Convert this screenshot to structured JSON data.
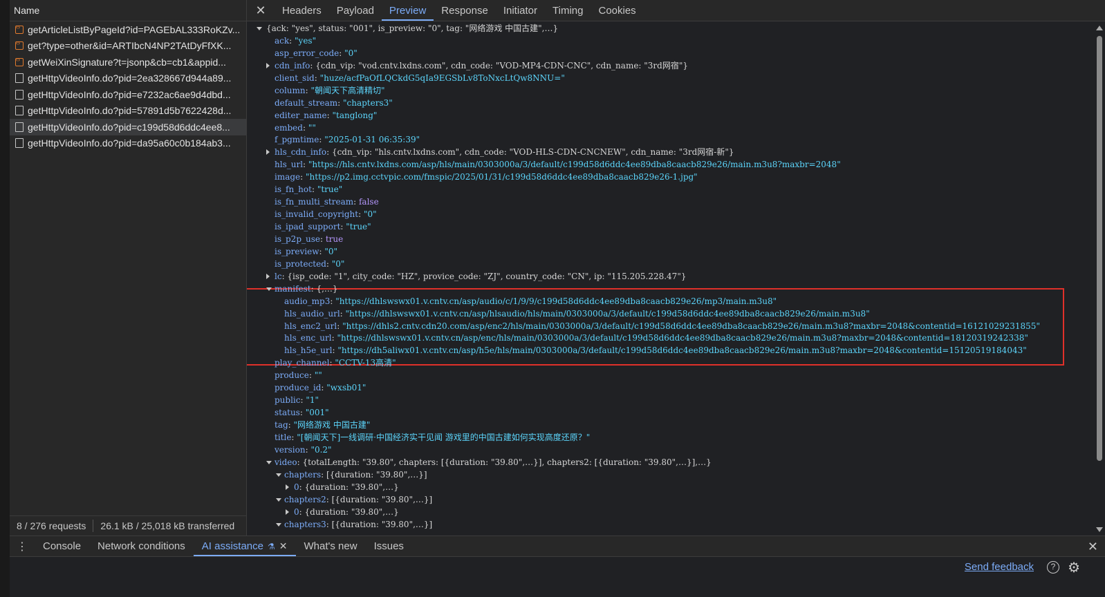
{
  "left_panel": {
    "column_header": "Name",
    "requests": [
      {
        "name": "getArticleListByPageId?id=PAGEbAL333RoKZv...",
        "type": "script",
        "selected": false
      },
      {
        "name": "get?type=other&id=ARTIbcN4NP2TAtDyFfXK...",
        "type": "script",
        "selected": false
      },
      {
        "name": "getWeiXinSignature?t=jsonp&cb=cb1&appid...",
        "type": "script",
        "selected": false
      },
      {
        "name": "getHttpVideoInfo.do?pid=2ea328667d944a89...",
        "type": "doc",
        "selected": false
      },
      {
        "name": "getHttpVideoInfo.do?pid=e7232ac6ae9d4dbd...",
        "type": "doc",
        "selected": false
      },
      {
        "name": "getHttpVideoInfo.do?pid=57891d5b7622428d...",
        "type": "doc",
        "selected": false
      },
      {
        "name": "getHttpVideoInfo.do?pid=c199d58d6ddc4ee8...",
        "type": "doc",
        "selected": true
      },
      {
        "name": "getHttpVideoInfo.do?pid=da95a60c0b184ab3...",
        "type": "doc",
        "selected": false
      }
    ],
    "status": {
      "requests": "8 / 276 requests",
      "transferred": "26.1 kB / 25,018 kB transferred"
    }
  },
  "detail_tabs": {
    "close": "✕",
    "tabs": [
      "Headers",
      "Payload",
      "Preview",
      "Response",
      "Initiator",
      "Timing",
      "Cookies"
    ],
    "active": "Preview"
  },
  "preview_lines": [
    {
      "indent": 0,
      "tri": "down",
      "parts": [
        {
          "c": "t",
          "v": "{ack: \"yes\", status: \"001\", is_preview: \"0\", tag: \"网络游戏 中国古建\",…}"
        }
      ]
    },
    {
      "indent": 1,
      "parts": [
        {
          "c": "k",
          "v": "ack"
        },
        {
          "c": "p",
          "v": ": "
        },
        {
          "c": "s",
          "v": "\"yes\""
        }
      ]
    },
    {
      "indent": 1,
      "parts": [
        {
          "c": "k",
          "v": "asp_error_code"
        },
        {
          "c": "p",
          "v": ": "
        },
        {
          "c": "s",
          "v": "\"0\""
        }
      ]
    },
    {
      "indent": 1,
      "tri": "right",
      "parts": [
        {
          "c": "k",
          "v": "cdn_info"
        },
        {
          "c": "p",
          "v": ": {cdn_vip: \"vod.cntv.lxdns.com\", cdn_code: \"VOD-MP4-CDN-CNC\", cdn_name: \"3rd网宿\"}"
        }
      ]
    },
    {
      "indent": 1,
      "parts": [
        {
          "c": "k",
          "v": "client_sid"
        },
        {
          "c": "p",
          "v": ": "
        },
        {
          "c": "s",
          "v": "\"huze/acfPaOfLQCkdG5qIa9EGSbLv8ToNxcLtQw8NNU=\""
        }
      ]
    },
    {
      "indent": 1,
      "parts": [
        {
          "c": "k",
          "v": "column"
        },
        {
          "c": "p",
          "v": ": "
        },
        {
          "c": "s",
          "v": "\"朝闻天下高清精切\""
        }
      ]
    },
    {
      "indent": 1,
      "parts": [
        {
          "c": "k",
          "v": "default_stream"
        },
        {
          "c": "p",
          "v": ": "
        },
        {
          "c": "s",
          "v": "\"chapters3\""
        }
      ]
    },
    {
      "indent": 1,
      "parts": [
        {
          "c": "k",
          "v": "editer_name"
        },
        {
          "c": "p",
          "v": ": "
        },
        {
          "c": "s",
          "v": "\"tanglong\""
        }
      ]
    },
    {
      "indent": 1,
      "parts": [
        {
          "c": "k",
          "v": "embed"
        },
        {
          "c": "p",
          "v": ": "
        },
        {
          "c": "s",
          "v": "\"\""
        }
      ]
    },
    {
      "indent": 1,
      "parts": [
        {
          "c": "k",
          "v": "f_pgmtime"
        },
        {
          "c": "p",
          "v": ": "
        },
        {
          "c": "s",
          "v": "\"2025-01-31 06:35:39\""
        }
      ]
    },
    {
      "indent": 1,
      "tri": "right",
      "parts": [
        {
          "c": "k",
          "v": "hls_cdn_info"
        },
        {
          "c": "p",
          "v": ": {cdn_vip: \"hls.cntv.lxdns.com\", cdn_code: \"VOD-HLS-CDN-CNCNEW\", cdn_name: \"3rd网宿-新\"}"
        }
      ]
    },
    {
      "indent": 1,
      "parts": [
        {
          "c": "k",
          "v": "hls_url"
        },
        {
          "c": "p",
          "v": ": "
        },
        {
          "c": "s",
          "v": "\"https://hls.cntv.lxdns.com/asp/hls/main/0303000a/3/default/c199d58d6ddc4ee89dba8caacb829e26/main.m3u8?maxbr=2048\""
        }
      ]
    },
    {
      "indent": 1,
      "parts": [
        {
          "c": "k",
          "v": "image"
        },
        {
          "c": "p",
          "v": ": "
        },
        {
          "c": "s",
          "v": "\"https://p2.img.cctvpic.com/fmspic/2025/01/31/c199d58d6ddc4ee89dba8caacb829e26-1.jpg\""
        }
      ]
    },
    {
      "indent": 1,
      "parts": [
        {
          "c": "k",
          "v": "is_fn_hot"
        },
        {
          "c": "p",
          "v": ": "
        },
        {
          "c": "s",
          "v": "\"true\""
        }
      ]
    },
    {
      "indent": 1,
      "parts": [
        {
          "c": "k",
          "v": "is_fn_multi_stream"
        },
        {
          "c": "p",
          "v": ": "
        },
        {
          "c": "n",
          "v": "false"
        }
      ]
    },
    {
      "indent": 1,
      "parts": [
        {
          "c": "k",
          "v": "is_invalid_copyright"
        },
        {
          "c": "p",
          "v": ": "
        },
        {
          "c": "s",
          "v": "\"0\""
        }
      ]
    },
    {
      "indent": 1,
      "parts": [
        {
          "c": "k",
          "v": "is_ipad_support"
        },
        {
          "c": "p",
          "v": ": "
        },
        {
          "c": "s",
          "v": "\"true\""
        }
      ]
    },
    {
      "indent": 1,
      "parts": [
        {
          "c": "k",
          "v": "is_p2p_use"
        },
        {
          "c": "p",
          "v": ": "
        },
        {
          "c": "n",
          "v": "true"
        }
      ]
    },
    {
      "indent": 1,
      "parts": [
        {
          "c": "k",
          "v": "is_preview"
        },
        {
          "c": "p",
          "v": ": "
        },
        {
          "c": "s",
          "v": "\"0\""
        }
      ]
    },
    {
      "indent": 1,
      "parts": [
        {
          "c": "k",
          "v": "is_protected"
        },
        {
          "c": "p",
          "v": ": "
        },
        {
          "c": "s",
          "v": "\"0\""
        }
      ]
    },
    {
      "indent": 1,
      "tri": "right",
      "parts": [
        {
          "c": "k",
          "v": "lc"
        },
        {
          "c": "p",
          "v": ": {isp_code: \"1\", city_code: \"HZ\", provice_code: \"ZJ\", country_code: \"CN\", ip: \"115.205.228.47\"}"
        }
      ]
    },
    {
      "indent": 1,
      "tri": "down",
      "parts": [
        {
          "c": "k",
          "v": "manifest"
        },
        {
          "c": "p",
          "v": ": {,…}"
        }
      ]
    },
    {
      "indent": 2,
      "parts": [
        {
          "c": "k",
          "v": "audio_mp3"
        },
        {
          "c": "p",
          "v": ": "
        },
        {
          "c": "s",
          "v": "\"https://dhlswswx01.v.cntv.cn/asp/audio/c/1/9/9/c199d58d6ddc4ee89dba8caacb829e26/mp3/main.m3u8\""
        }
      ]
    },
    {
      "indent": 2,
      "parts": [
        {
          "c": "k",
          "v": "hls_audio_url"
        },
        {
          "c": "p",
          "v": ": "
        },
        {
          "c": "s",
          "v": "\"https://dhlswswx01.v.cntv.cn/asp/hlsaudio/hls/main/0303000a/3/default/c199d58d6ddc4ee89dba8caacb829e26/main.m3u8\""
        }
      ]
    },
    {
      "indent": 2,
      "parts": [
        {
          "c": "k",
          "v": "hls_enc2_url"
        },
        {
          "c": "p",
          "v": ": "
        },
        {
          "c": "s",
          "v": "\"https://dhls2.cntv.cdn20.com/asp/enc2/hls/main/0303000a/3/default/c199d58d6ddc4ee89dba8caacb829e26/main.m3u8?maxbr=2048&contentid=16121029231855\""
        }
      ]
    },
    {
      "indent": 2,
      "parts": [
        {
          "c": "k",
          "v": "hls_enc_url"
        },
        {
          "c": "p",
          "v": ": "
        },
        {
          "c": "s",
          "v": "\"https://dhlswswx01.v.cntv.cn/asp/enc/hls/main/0303000a/3/default/c199d58d6ddc4ee89dba8caacb829e26/main.m3u8?maxbr=2048&contentid=18120319242338\""
        }
      ]
    },
    {
      "indent": 2,
      "parts": [
        {
          "c": "k",
          "v": "hls_h5e_url"
        },
        {
          "c": "p",
          "v": ": "
        },
        {
          "c": "s",
          "v": "\"https://dh5aliwx01.v.cntv.cn/asp/h5e/hls/main/0303000a/3/default/c199d58d6ddc4ee89dba8caacb829e26/main.m3u8?maxbr=2048&contentid=15120519184043\""
        }
      ]
    },
    {
      "indent": 1,
      "parts": [
        {
          "c": "k",
          "v": "play_channel"
        },
        {
          "c": "p",
          "v": ": "
        },
        {
          "c": "s",
          "v": "\"CCTV-13高清\""
        }
      ]
    },
    {
      "indent": 1,
      "parts": [
        {
          "c": "k",
          "v": "produce"
        },
        {
          "c": "p",
          "v": ": "
        },
        {
          "c": "s",
          "v": "\"\""
        }
      ]
    },
    {
      "indent": 1,
      "parts": [
        {
          "c": "k",
          "v": "produce_id"
        },
        {
          "c": "p",
          "v": ": "
        },
        {
          "c": "s",
          "v": "\"wxsb01\""
        }
      ]
    },
    {
      "indent": 1,
      "parts": [
        {
          "c": "k",
          "v": "public"
        },
        {
          "c": "p",
          "v": ": "
        },
        {
          "c": "s",
          "v": "\"1\""
        }
      ]
    },
    {
      "indent": 1,
      "parts": [
        {
          "c": "k",
          "v": "status"
        },
        {
          "c": "p",
          "v": ": "
        },
        {
          "c": "s",
          "v": "\"001\""
        }
      ]
    },
    {
      "indent": 1,
      "parts": [
        {
          "c": "k",
          "v": "tag"
        },
        {
          "c": "p",
          "v": ": "
        },
        {
          "c": "s",
          "v": "\"网络游戏 中国古建\""
        }
      ]
    },
    {
      "indent": 1,
      "parts": [
        {
          "c": "k",
          "v": "title"
        },
        {
          "c": "p",
          "v": ": "
        },
        {
          "c": "s",
          "v": "\"[朝闻天下]一线调研·中国经济实干见闻 游戏里的中国古建如何实现高度还原？\""
        }
      ]
    },
    {
      "indent": 1,
      "parts": [
        {
          "c": "k",
          "v": "version"
        },
        {
          "c": "p",
          "v": ": "
        },
        {
          "c": "s",
          "v": "\"0.2\""
        }
      ]
    },
    {
      "indent": 1,
      "tri": "down",
      "parts": [
        {
          "c": "k",
          "v": "video"
        },
        {
          "c": "p",
          "v": ": {totalLength: \"39.80\", chapters: [{duration: \"39.80\",…}], chapters2: [{duration: \"39.80\",…}],…}"
        }
      ]
    },
    {
      "indent": 2,
      "tri": "down",
      "parts": [
        {
          "c": "k",
          "v": "chapters"
        },
        {
          "c": "p",
          "v": ": [{duration: \"39.80\",…}]"
        }
      ]
    },
    {
      "indent": 3,
      "tri": "right",
      "parts": [
        {
          "c": "k",
          "v": "0"
        },
        {
          "c": "p",
          "v": ": {duration: \"39.80\",…}"
        }
      ]
    },
    {
      "indent": 2,
      "tri": "down",
      "parts": [
        {
          "c": "k",
          "v": "chapters2"
        },
        {
          "c": "p",
          "v": ": [{duration: \"39.80\",…}]"
        }
      ]
    },
    {
      "indent": 3,
      "tri": "right",
      "parts": [
        {
          "c": "k",
          "v": "0"
        },
        {
          "c": "p",
          "v": ": {duration: \"39.80\",…}"
        }
      ]
    },
    {
      "indent": 2,
      "tri": "down",
      "parts": [
        {
          "c": "k",
          "v": "chapters3"
        },
        {
          "c": "p",
          "v": ": [{duration: \"39.80\",…}]"
        }
      ]
    }
  ],
  "drawer": {
    "tabs": [
      "Console",
      "Network conditions",
      "AI assistance",
      "What's new",
      "Issues"
    ],
    "active": "AI assistance",
    "feedback": "Send feedback",
    "help_glyph": "?"
  },
  "colors": {
    "accent": "#7cacf8",
    "key": "#7cacf8",
    "string": "#5cd5fb",
    "keyword": "#b597fd",
    "highlight_border": "#e0302a"
  }
}
